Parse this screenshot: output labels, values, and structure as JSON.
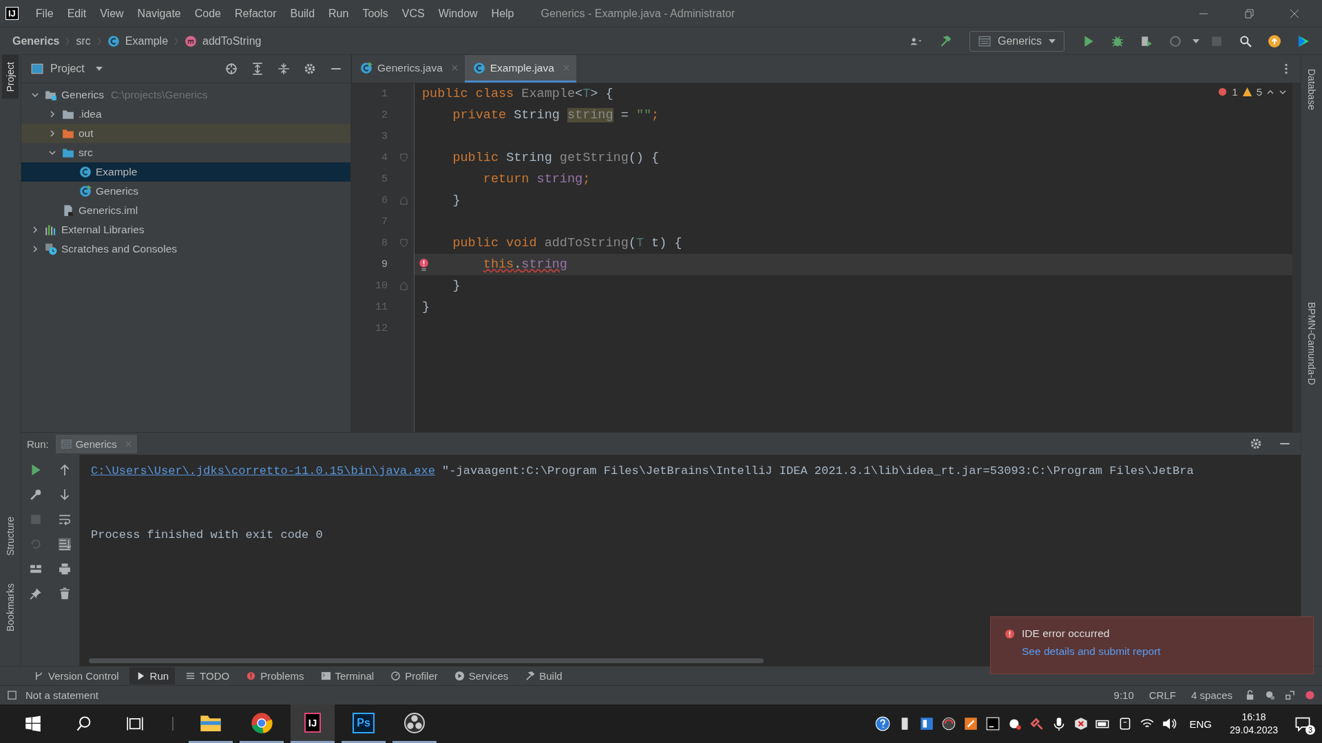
{
  "app_logo": "IJ",
  "menu": [
    "File",
    "Edit",
    "View",
    "Navigate",
    "Code",
    "Refactor",
    "Build",
    "Run",
    "Tools",
    "VCS",
    "Window",
    "Help"
  ],
  "window_title": "Generics - Example.java - Administrator",
  "breadcrumbs": [
    {
      "label": "Generics",
      "kind": "project"
    },
    {
      "label": "src",
      "kind": "folder"
    },
    {
      "label": "Example",
      "kind": "class"
    },
    {
      "label": "addToString",
      "kind": "method"
    }
  ],
  "run_config": "Generics",
  "left_stripe": [
    {
      "label": "Project",
      "selected": true
    },
    {
      "label": "Structure",
      "selected": false
    },
    {
      "label": "Bookmarks",
      "selected": false
    }
  ],
  "right_stripe": [
    {
      "label": "Database",
      "selected": false
    },
    {
      "label": "BPMN-Camunda-D",
      "selected": false
    }
  ],
  "project_panel": {
    "title": "Project",
    "tree": [
      {
        "label": "Generics",
        "hint": "C:\\projects\\Generics",
        "kind": "module",
        "expanded": true,
        "selected": false,
        "children": [
          {
            "label": ".idea",
            "kind": "folder",
            "expanded": false,
            "selected": false
          },
          {
            "label": "out",
            "kind": "folder_excluded",
            "expanded": false,
            "selected": false
          },
          {
            "label": "src",
            "kind": "source_folder",
            "expanded": true,
            "selected": false,
            "children": [
              {
                "label": "Example",
                "kind": "class",
                "selected": true
              },
              {
                "label": "Generics",
                "kind": "class_main",
                "selected": false
              }
            ]
          },
          {
            "label": "Generics.iml",
            "kind": "iml",
            "selected": false
          }
        ]
      },
      {
        "label": "External Libraries",
        "kind": "libraries",
        "expanded": false,
        "selected": false
      },
      {
        "label": "Scratches and Consoles",
        "kind": "scratches",
        "expanded": false,
        "selected": false
      }
    ]
  },
  "editor": {
    "tabs": [
      {
        "label": "Generics.java",
        "kind": "class_main",
        "selected": false
      },
      {
        "label": "Example.java",
        "kind": "class",
        "selected": true
      }
    ],
    "errors": "1",
    "warnings": "5",
    "lines": [
      {
        "number": "1",
        "kind": "class_start",
        "current": false,
        "error": false,
        "tokens": [
          {
            "text": "public class ",
            "kind": "keyword"
          },
          {
            "text": "Example",
            "kind": "unused"
          },
          {
            "text": "<",
            "kind": "plain"
          },
          {
            "text": "T",
            "kind": "type_param"
          },
          {
            "text": "> {",
            "kind": "plain"
          }
        ]
      },
      {
        "number": "2",
        "kind": "field",
        "current": false,
        "error": false,
        "tokens": [
          {
            "text": "private ",
            "kind": "keyword"
          },
          {
            "text": "String ",
            "kind": "plain"
          },
          {
            "text": "string",
            "kind": "usage"
          },
          {
            "text": " = ",
            "kind": "plain"
          },
          {
            "text": "\"\"",
            "kind": "string"
          },
          {
            "text": ";",
            "kind": "keyword"
          }
        ]
      },
      {
        "number": "3",
        "current": false,
        "error": false
      },
      {
        "number": "4",
        "kind": "method_start",
        "current": false,
        "error": false,
        "tokens": [
          {
            "text": "public ",
            "kind": "keyword"
          },
          {
            "text": "String ",
            "kind": "plain"
          },
          {
            "text": "getString",
            "kind": "unused"
          },
          {
            "text": "() {",
            "kind": "plain"
          }
        ]
      },
      {
        "number": "5",
        "kind": "statement",
        "current": false,
        "error": false,
        "tokens": [
          {
            "text": "return ",
            "kind": "keyword"
          },
          {
            "text": "string",
            "kind": "field"
          },
          {
            "text": ";",
            "kind": "keyword"
          }
        ]
      },
      {
        "number": "6",
        "kind": "block_end",
        "current": false,
        "error": false,
        "tokens": [
          {
            "text": "}",
            "kind": "plain"
          }
        ]
      },
      {
        "number": "7",
        "current": false,
        "error": false
      },
      {
        "number": "8",
        "kind": "method_start",
        "current": false,
        "error": false,
        "tokens": [
          {
            "text": "public void ",
            "kind": "keyword"
          },
          {
            "text": "addToString",
            "kind": "unused"
          },
          {
            "text": "(",
            "kind": "plain"
          },
          {
            "text": "T",
            "kind": "type_param"
          },
          {
            "text": " t) {",
            "kind": "plain"
          }
        ]
      },
      {
        "number": "9",
        "kind": "statement",
        "current": true,
        "error": true,
        "tokens": [
          {
            "text": "this",
            "kind": "keyword"
          },
          {
            "text": ".",
            "kind": "plain"
          },
          {
            "text": "string",
            "kind": "field"
          }
        ]
      },
      {
        "number": "10",
        "kind": "block_end",
        "current": false,
        "error": false,
        "tokens": [
          {
            "text": "}",
            "kind": "plain"
          }
        ]
      },
      {
        "number": "11",
        "kind": "class_end",
        "current": false,
        "error": false,
        "tokens": [
          {
            "text": "}",
            "kind": "plain"
          }
        ]
      },
      {
        "number": "12",
        "current": false,
        "error": false
      }
    ]
  },
  "run_panel": {
    "label": "Run:",
    "tabs": [
      {
        "label": "Generics",
        "selected": true
      }
    ],
    "command": {
      "path": "C:\\Users\\User\\.jdks\\corretto-11.0.15\\bin\\java.exe",
      "args": "\"-javaagent:C:\\Program Files\\JetBrains\\IntelliJ IDEA 2021.3.1\\lib\\idea_rt.jar=53093:C:\\Program Files\\JetBra"
    },
    "exit_message": "Process finished with exit code 0"
  },
  "tool_windows": [
    {
      "label": "Version Control",
      "kind": "branch",
      "selected": false
    },
    {
      "label": "Run",
      "kind": "run",
      "selected": true
    },
    {
      "label": "TODO",
      "kind": "list",
      "selected": false
    },
    {
      "label": "Problems",
      "kind": "problem",
      "selected": false
    },
    {
      "label": "Terminal",
      "kind": "terminal",
      "selected": false
    },
    {
      "label": "Profiler",
      "kind": "profiler",
      "selected": false
    },
    {
      "label": "Services",
      "kind": "services",
      "selected": false
    },
    {
      "label": "Build",
      "kind": "hammer",
      "selected": false
    }
  ],
  "status": {
    "message": "Not a statement",
    "position": "9:10",
    "line_separator": "CRLF",
    "indent": "4 spaces"
  },
  "notification": {
    "title": "IDE error occurred",
    "link": "See details and submit report"
  },
  "taskbar": {
    "apps": [
      {
        "kind": "explorer",
        "active": false
      },
      {
        "kind": "chrome",
        "active": false
      },
      {
        "kind": "intellij",
        "glyph": "IJ",
        "active": true
      },
      {
        "kind": "photoshop",
        "glyph": "Ps",
        "active": false
      },
      {
        "kind": "obs",
        "active": false
      }
    ],
    "language": "ENG",
    "time": "16:18",
    "date": "29.04.2023",
    "notification_count": "3"
  }
}
